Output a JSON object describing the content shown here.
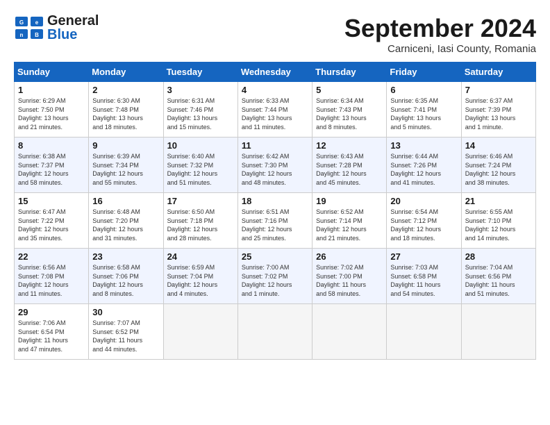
{
  "header": {
    "logo_line1": "General",
    "logo_line2": "Blue",
    "month_year": "September 2024",
    "location": "Carniceni, Iasi County, Romania"
  },
  "weekdays": [
    "Sunday",
    "Monday",
    "Tuesday",
    "Wednesday",
    "Thursday",
    "Friday",
    "Saturday"
  ],
  "weeks": [
    [
      {
        "day": "1",
        "info": "Sunrise: 6:29 AM\nSunset: 7:50 PM\nDaylight: 13 hours\nand 21 minutes."
      },
      {
        "day": "2",
        "info": "Sunrise: 6:30 AM\nSunset: 7:48 PM\nDaylight: 13 hours\nand 18 minutes."
      },
      {
        "day": "3",
        "info": "Sunrise: 6:31 AM\nSunset: 7:46 PM\nDaylight: 13 hours\nand 15 minutes."
      },
      {
        "day": "4",
        "info": "Sunrise: 6:33 AM\nSunset: 7:44 PM\nDaylight: 13 hours\nand 11 minutes."
      },
      {
        "day": "5",
        "info": "Sunrise: 6:34 AM\nSunset: 7:43 PM\nDaylight: 13 hours\nand 8 minutes."
      },
      {
        "day": "6",
        "info": "Sunrise: 6:35 AM\nSunset: 7:41 PM\nDaylight: 13 hours\nand 5 minutes."
      },
      {
        "day": "7",
        "info": "Sunrise: 6:37 AM\nSunset: 7:39 PM\nDaylight: 13 hours\nand 1 minute."
      }
    ],
    [
      {
        "day": "8",
        "info": "Sunrise: 6:38 AM\nSunset: 7:37 PM\nDaylight: 12 hours\nand 58 minutes."
      },
      {
        "day": "9",
        "info": "Sunrise: 6:39 AM\nSunset: 7:34 PM\nDaylight: 12 hours\nand 55 minutes."
      },
      {
        "day": "10",
        "info": "Sunrise: 6:40 AM\nSunset: 7:32 PM\nDaylight: 12 hours\nand 51 minutes."
      },
      {
        "day": "11",
        "info": "Sunrise: 6:42 AM\nSunset: 7:30 PM\nDaylight: 12 hours\nand 48 minutes."
      },
      {
        "day": "12",
        "info": "Sunrise: 6:43 AM\nSunset: 7:28 PM\nDaylight: 12 hours\nand 45 minutes."
      },
      {
        "day": "13",
        "info": "Sunrise: 6:44 AM\nSunset: 7:26 PM\nDaylight: 12 hours\nand 41 minutes."
      },
      {
        "day": "14",
        "info": "Sunrise: 6:46 AM\nSunset: 7:24 PM\nDaylight: 12 hours\nand 38 minutes."
      }
    ],
    [
      {
        "day": "15",
        "info": "Sunrise: 6:47 AM\nSunset: 7:22 PM\nDaylight: 12 hours\nand 35 minutes."
      },
      {
        "day": "16",
        "info": "Sunrise: 6:48 AM\nSunset: 7:20 PM\nDaylight: 12 hours\nand 31 minutes."
      },
      {
        "day": "17",
        "info": "Sunrise: 6:50 AM\nSunset: 7:18 PM\nDaylight: 12 hours\nand 28 minutes."
      },
      {
        "day": "18",
        "info": "Sunrise: 6:51 AM\nSunset: 7:16 PM\nDaylight: 12 hours\nand 25 minutes."
      },
      {
        "day": "19",
        "info": "Sunrise: 6:52 AM\nSunset: 7:14 PM\nDaylight: 12 hours\nand 21 minutes."
      },
      {
        "day": "20",
        "info": "Sunrise: 6:54 AM\nSunset: 7:12 PM\nDaylight: 12 hours\nand 18 minutes."
      },
      {
        "day": "21",
        "info": "Sunrise: 6:55 AM\nSunset: 7:10 PM\nDaylight: 12 hours\nand 14 minutes."
      }
    ],
    [
      {
        "day": "22",
        "info": "Sunrise: 6:56 AM\nSunset: 7:08 PM\nDaylight: 12 hours\nand 11 minutes."
      },
      {
        "day": "23",
        "info": "Sunrise: 6:58 AM\nSunset: 7:06 PM\nDaylight: 12 hours\nand 8 minutes."
      },
      {
        "day": "24",
        "info": "Sunrise: 6:59 AM\nSunset: 7:04 PM\nDaylight: 12 hours\nand 4 minutes."
      },
      {
        "day": "25",
        "info": "Sunrise: 7:00 AM\nSunset: 7:02 PM\nDaylight: 12 hours\nand 1 minute."
      },
      {
        "day": "26",
        "info": "Sunrise: 7:02 AM\nSunset: 7:00 PM\nDaylight: 11 hours\nand 58 minutes."
      },
      {
        "day": "27",
        "info": "Sunrise: 7:03 AM\nSunset: 6:58 PM\nDaylight: 11 hours\nand 54 minutes."
      },
      {
        "day": "28",
        "info": "Sunrise: 7:04 AM\nSunset: 6:56 PM\nDaylight: 11 hours\nand 51 minutes."
      }
    ],
    [
      {
        "day": "29",
        "info": "Sunrise: 7:06 AM\nSunset: 6:54 PM\nDaylight: 11 hours\nand 47 minutes."
      },
      {
        "day": "30",
        "info": "Sunrise: 7:07 AM\nSunset: 6:52 PM\nDaylight: 11 hours\nand 44 minutes."
      },
      {
        "day": "",
        "info": ""
      },
      {
        "day": "",
        "info": ""
      },
      {
        "day": "",
        "info": ""
      },
      {
        "day": "",
        "info": ""
      },
      {
        "day": "",
        "info": ""
      }
    ]
  ]
}
